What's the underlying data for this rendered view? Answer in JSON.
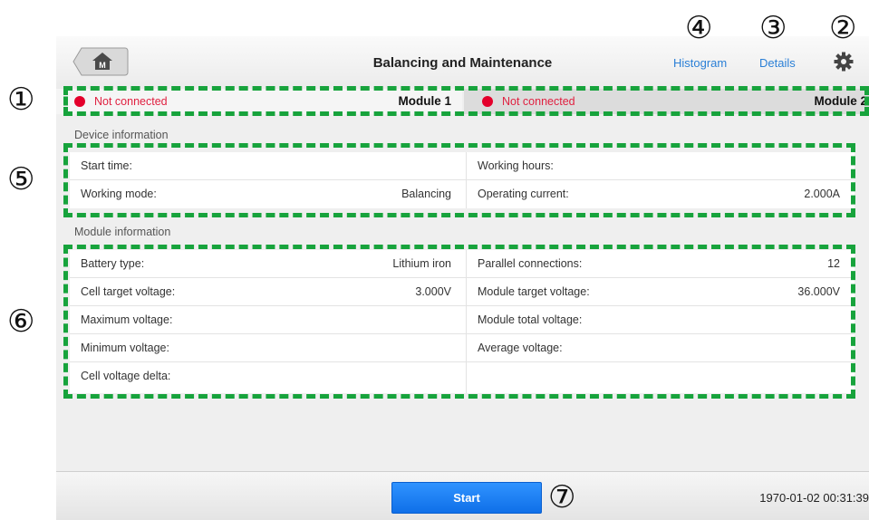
{
  "header": {
    "title": "Balancing and Maintenance",
    "histogram_label": "Histogram",
    "details_label": "Details",
    "home_letter": "M"
  },
  "callouts": [
    "①",
    "②",
    "③",
    "④",
    "⑤",
    "⑥",
    "⑦"
  ],
  "modules": [
    {
      "status": "Not connected",
      "name": "Module 1"
    },
    {
      "status": "Not connected",
      "name": "Module 2"
    }
  ],
  "device_info": {
    "label": "Device information",
    "start_time": {
      "key": "Start time:",
      "value": ""
    },
    "working_hours": {
      "key": "Working hours:",
      "value": ""
    },
    "working_mode": {
      "key": "Working mode:",
      "value": "Balancing"
    },
    "operating_current": {
      "key": "Operating current:",
      "value": "2.000A"
    }
  },
  "module_info": {
    "label": "Module information",
    "battery_type": {
      "key": "Battery type:",
      "value": "Lithium iron"
    },
    "parallel_connections": {
      "key": "Parallel connections:",
      "value": "12"
    },
    "cell_target_voltage": {
      "key": "Cell target voltage:",
      "value": "3.000V"
    },
    "module_target_voltage": {
      "key": "Module target voltage:",
      "value": "36.000V"
    },
    "maximum_voltage": {
      "key": "Maximum voltage:",
      "value": ""
    },
    "module_total_voltage": {
      "key": "Module total voltage:",
      "value": ""
    },
    "minimum_voltage": {
      "key": "Minimum voltage:",
      "value": ""
    },
    "average_voltage": {
      "key": "Average voltage:",
      "value": ""
    },
    "cell_voltage_delta": {
      "key": "Cell voltage delta:",
      "value": ""
    }
  },
  "footer": {
    "start_label": "Start",
    "timestamp": "1970-01-02 00:31:39"
  },
  "colors": {
    "accent_blue": "#2a7fd6",
    "status_red": "#e4002b",
    "callout_green": "#17a33c"
  }
}
